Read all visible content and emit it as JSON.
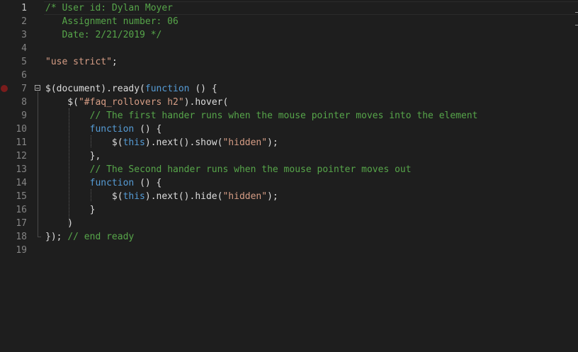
{
  "editor": {
    "lines": [
      {
        "num": "1",
        "segments": [
          {
            "cls": "cm",
            "text": "/* User id: Dylan Moyer"
          }
        ]
      },
      {
        "num": "2",
        "segments": [
          {
            "cls": "cm",
            "text": "   Assignment number: 06"
          }
        ]
      },
      {
        "num": "3",
        "segments": [
          {
            "cls": "cm",
            "text": "   Date: 2/21/2019 */"
          }
        ]
      },
      {
        "num": "4",
        "segments": []
      },
      {
        "num": "5",
        "segments": [
          {
            "cls": "st",
            "text": "\"use strict\""
          },
          {
            "cls": "pn",
            "text": ";"
          }
        ]
      },
      {
        "num": "6",
        "segments": []
      },
      {
        "num": "7",
        "segments": [
          {
            "cls": "pn",
            "text": "$(document).ready("
          },
          {
            "cls": "kw",
            "text": "function"
          },
          {
            "cls": "pn",
            "text": " () {"
          }
        ]
      },
      {
        "num": "8",
        "segments": [
          {
            "cls": "pn",
            "text": "    $("
          },
          {
            "cls": "st",
            "text": "\"#faq_rollovers h2\""
          },
          {
            "cls": "pn",
            "text": ").hover("
          }
        ]
      },
      {
        "num": "9",
        "segments": [
          {
            "cls": "pn",
            "text": "        "
          },
          {
            "cls": "cm",
            "text": "// The first hander runs when the mouse pointer moves into the element"
          }
        ]
      },
      {
        "num": "10",
        "segments": [
          {
            "cls": "pn",
            "text": "        "
          },
          {
            "cls": "kw",
            "text": "function"
          },
          {
            "cls": "pn",
            "text": " () {"
          }
        ]
      },
      {
        "num": "11",
        "segments": [
          {
            "cls": "pn",
            "text": "            $("
          },
          {
            "cls": "kw",
            "text": "this"
          },
          {
            "cls": "pn",
            "text": ").next().show("
          },
          {
            "cls": "st",
            "text": "\"hidden\""
          },
          {
            "cls": "pn",
            "text": ");"
          }
        ]
      },
      {
        "num": "12",
        "segments": [
          {
            "cls": "pn",
            "text": "        },"
          }
        ]
      },
      {
        "num": "13",
        "segments": [
          {
            "cls": "pn",
            "text": "        "
          },
          {
            "cls": "cm",
            "text": "// The Second hander runs when the mouse pointer moves out"
          }
        ]
      },
      {
        "num": "14",
        "segments": [
          {
            "cls": "pn",
            "text": "        "
          },
          {
            "cls": "kw",
            "text": "function"
          },
          {
            "cls": "pn",
            "text": " () {"
          }
        ]
      },
      {
        "num": "15",
        "segments": [
          {
            "cls": "pn",
            "text": "            $("
          },
          {
            "cls": "kw",
            "text": "this"
          },
          {
            "cls": "pn",
            "text": ").next().hide("
          },
          {
            "cls": "st",
            "text": "\"hidden\""
          },
          {
            "cls": "pn",
            "text": ");"
          }
        ]
      },
      {
        "num": "16",
        "segments": [
          {
            "cls": "pn",
            "text": "        }"
          }
        ]
      },
      {
        "num": "17",
        "segments": [
          {
            "cls": "pn",
            "text": "    )"
          }
        ]
      },
      {
        "num": "18",
        "segments": [
          {
            "cls": "pn",
            "text": "}); "
          },
          {
            "cls": "cm",
            "text": "// end ready"
          }
        ]
      },
      {
        "num": "19",
        "segments": []
      }
    ],
    "active_line": "1"
  },
  "colors": {
    "background": "#1e1e1e",
    "comment": "#57a64a",
    "string": "#d69d85",
    "keyword": "#569cd6",
    "text": "#dcdcdc",
    "line_number": "#858585",
    "breakpoint": "#7a1c1c"
  },
  "icons": {
    "breakpoint": "breakpoint-icon",
    "collapse": "collapse-minus-icon"
  }
}
